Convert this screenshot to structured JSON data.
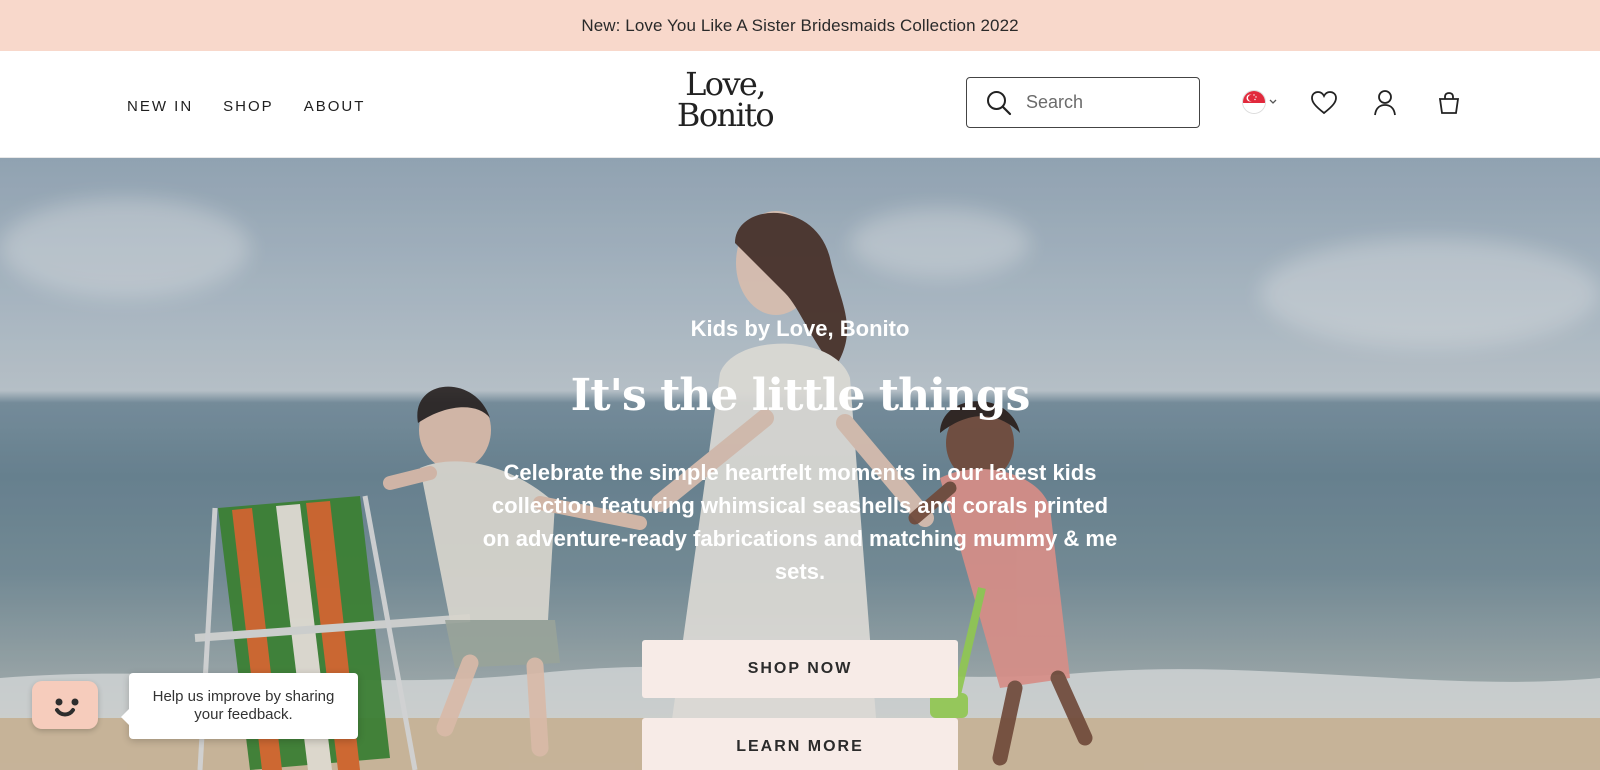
{
  "announcement": {
    "text": "New: Love You Like A Sister Bridesmaids Collection 2022"
  },
  "nav": {
    "items": [
      {
        "label": "NEW IN"
      },
      {
        "label": "SHOP"
      },
      {
        "label": "ABOUT"
      }
    ]
  },
  "brand": {
    "line1": "Love,",
    "line2": "Bonito"
  },
  "search": {
    "placeholder": "Search",
    "value": ""
  },
  "header_icons": {
    "country": "singapore-flag-icon",
    "wishlist": "heart-icon",
    "account": "user-icon",
    "cart": "shopping-bag-icon"
  },
  "hero": {
    "eyebrow": "Kids by Love, Bonito",
    "headline": "It's the little things",
    "description": "Celebrate the simple heartfelt moments in our latest kids collection featuring whimsical seashells and corals printed on adventure-ready fabrications and matching mummy & me sets.",
    "primary_button": "SHOP NOW",
    "secondary_button": "LEARN MORE"
  },
  "feedback": {
    "text": "Help us improve by sharing your feedback."
  },
  "colors": {
    "announcement_bg": "#f8d8cb",
    "button_bg": "#f7ebe7",
    "text": "#1f1f1f"
  }
}
